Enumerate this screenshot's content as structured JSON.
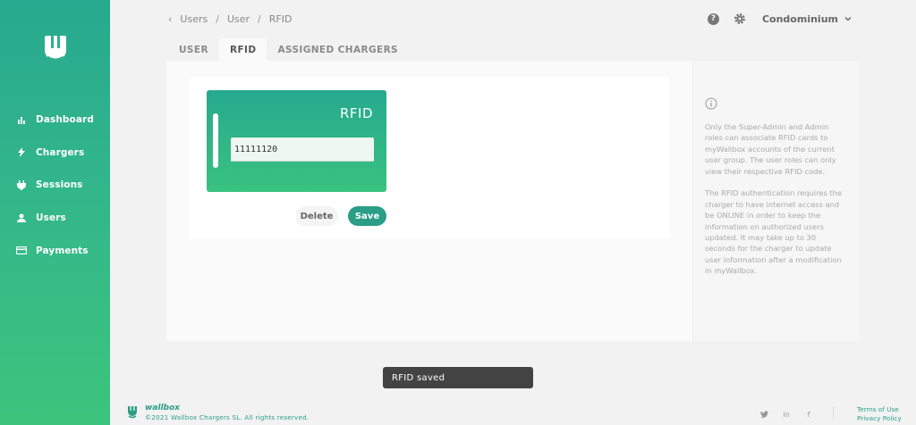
{
  "sidebar": {
    "items": [
      {
        "label": "Dashboard",
        "icon": "bar-chart-icon"
      },
      {
        "label": "Chargers",
        "icon": "bolt-icon"
      },
      {
        "label": "Sessions",
        "icon": "plug-icon"
      },
      {
        "label": "Users",
        "icon": "user-icon"
      },
      {
        "label": "Payments",
        "icon": "credit-card-icon"
      }
    ]
  },
  "breadcrumb": {
    "items": [
      "Users",
      "User",
      "RFID"
    ]
  },
  "header": {
    "organization": "Condominium"
  },
  "tabs": [
    {
      "label": "USER",
      "active": false
    },
    {
      "label": "RFID",
      "active": true
    },
    {
      "label": "ASSIGNED CHARGERS",
      "active": false
    }
  ],
  "rfid_card": {
    "title": "RFID",
    "value": "11111120",
    "delete_label": "Delete",
    "save_label": "Save"
  },
  "info": {
    "paragraph1": "Only the Super-Admin and Admin roles can associate RFID cards to myWallbox accounts of the current user group. The user roles can only view their respective RFID code.",
    "paragraph2": "The RFID authentication requires the charger to have internet access and be ONLINE in order to keep the information on authorized users updated. It may take up to 30 seconds for the charger to update user information after a modification in myWallbox."
  },
  "toast": {
    "message": "RFID saved"
  },
  "footer": {
    "brand": "wallbox",
    "copyright": "©2021 Wallbox Chargers SL. All rights reserved.",
    "terms": "Terms of Use",
    "privacy": "Privacy Policy"
  },
  "colors": {
    "accent": "#2a9e86",
    "sidebar_top": "#27a98f",
    "sidebar_bottom": "#3cc47c",
    "toast": "#434343"
  }
}
